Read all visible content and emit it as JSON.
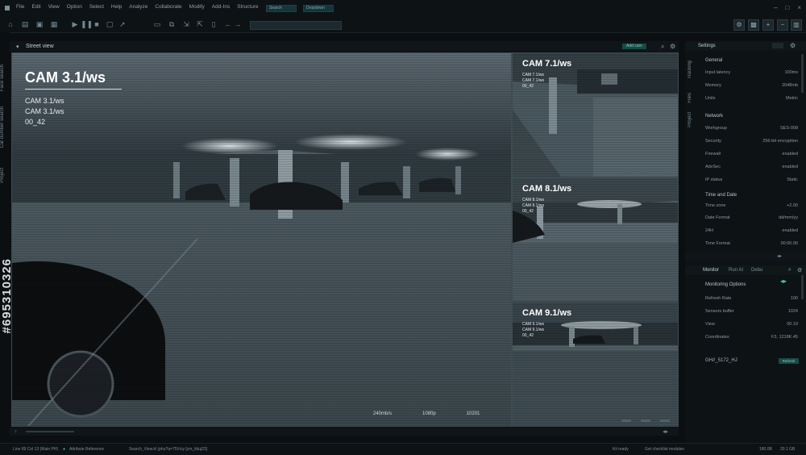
{
  "menu": {
    "items": [
      "File",
      "Edit",
      "View",
      "Option",
      "Select",
      "Help",
      "Analyze",
      "Collaborate",
      "Modify",
      "Add-Ins",
      "Structure"
    ],
    "search_label": "Search",
    "dropdown_label": "Dropdown"
  },
  "left_tabs": [
    "Face search",
    "Car number search",
    "Project"
  ],
  "watermark_id": "#695310326",
  "viewer": {
    "title": "Street view",
    "add_button": "Add cam"
  },
  "main_cam": {
    "title": "CAM 3.1/ws",
    "sub1": "CAM 3.1/ws",
    "sub2": "CAM 3.1/ws",
    "sub3": "00_42",
    "stats": [
      "240mb/s",
      "1080p",
      "10201"
    ]
  },
  "side_cams": [
    {
      "title": "CAM 7.1/ws",
      "sub1": "CAM 7.1/ws",
      "sub2": "CAM 7.1/ws",
      "sub3": "00_42"
    },
    {
      "title": "CAM 8.1/ws",
      "sub1": "CAM 8.1/ws",
      "sub2": "CAM 8.1/ws",
      "sub3": "00_42"
    },
    {
      "title": "CAM 9.1/ws",
      "sub1": "CAM 9.1/ws",
      "sub2": "CAM 9.1/ws",
      "sub3": "00_42"
    }
  ],
  "settings": {
    "title": "Settings",
    "tabs": [
      "Tracking",
      "Files",
      "Project"
    ],
    "general": {
      "title": "General",
      "rows": [
        {
          "k": "Input latency",
          "v": "100ms"
        },
        {
          "k": "Memory",
          "v": "2048mb"
        },
        {
          "k": "Units",
          "v": "Metric"
        }
      ]
    },
    "network": {
      "title": "Network",
      "rows": [
        {
          "k": "Workgroup",
          "v": "SES-008"
        },
        {
          "k": "Security",
          "v": "256-bit encryption"
        },
        {
          "k": "Firewall",
          "v": "enabled"
        },
        {
          "k": "AdvSec",
          "v": "enabled"
        },
        {
          "k": "IP status",
          "v": "Static"
        }
      ]
    },
    "datetime": {
      "title": "Time and Date",
      "rows": [
        {
          "k": "Time zone",
          "v": "+2.00"
        },
        {
          "k": "Date Format",
          "v": "dd/mm/yy"
        },
        {
          "k": "24H",
          "v": "enabled"
        },
        {
          "k": "Time Format",
          "v": "00:00.00"
        }
      ]
    }
  },
  "monitor": {
    "tabs": [
      "Monitor",
      "Run AI",
      "Debu"
    ],
    "title": "Monitoring Options",
    "rows": [
      {
        "k": "Refresh Rate",
        "v": "100"
      },
      {
        "k": "Sensors buffer",
        "v": "1024"
      },
      {
        "k": "View",
        "v": "00.19"
      },
      {
        "k": "Coordinates",
        "v": "F3, 1218K.45"
      }
    ],
    "code": "GH//_5172_HJ",
    "apply_label": "Refresh"
  },
  "status": {
    "left": "Line 89 Col 13 (Main PH)",
    "ref": "Attribute Reference",
    "path": "Search_View.kl (phu?q=75Vciy [cm_ilduj23]",
    "ready": "Kit ready",
    "check": "Get checklist modules",
    "mem1": "180.0B",
    "mem2": "20.1 GB"
  },
  "colors": {
    "accent": "#1a4a45",
    "accent_text": "#7fd0c3",
    "frame": "#3d4c52"
  }
}
